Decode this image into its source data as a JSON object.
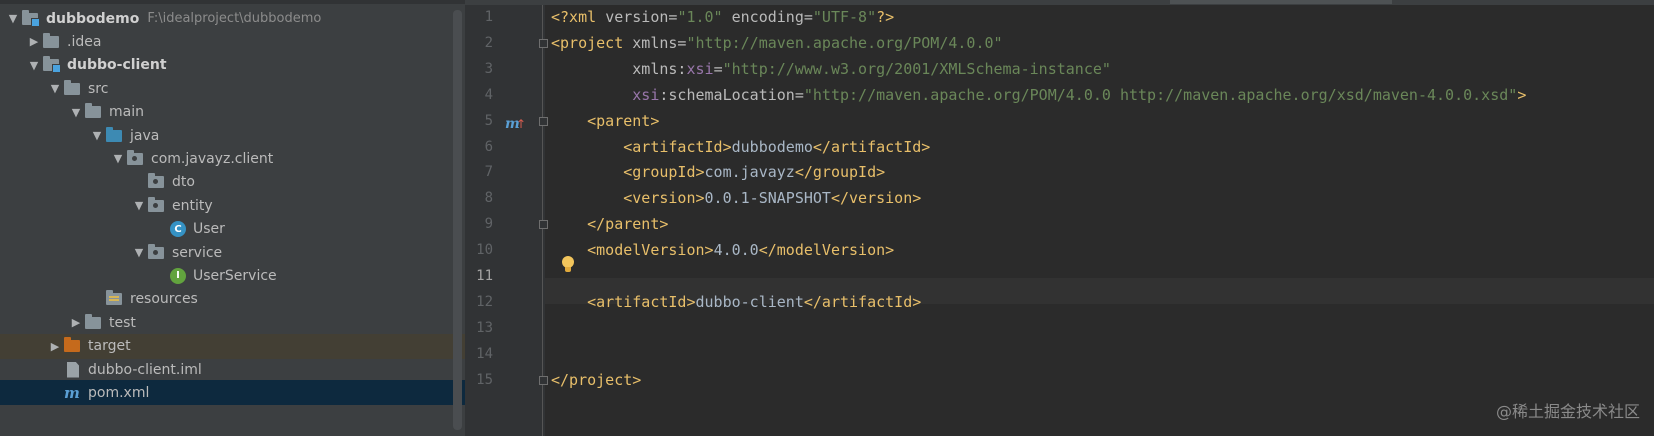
{
  "project_tree": [
    {
      "label": "dubbodemo",
      "path": "F:\\idealproject\\dubbodemo",
      "bold": true,
      "arrow": "down",
      "icon": "module-folder-icon"
    },
    {
      "label": ".idea",
      "arrow": "right",
      "icon": "folder-icon"
    },
    {
      "label": "dubbo-client",
      "bold": true,
      "arrow": "down",
      "icon": "module-folder-icon"
    },
    {
      "label": "src",
      "arrow": "down",
      "icon": "folder-icon"
    },
    {
      "label": "main",
      "arrow": "down",
      "icon": "folder-icon"
    },
    {
      "label": "java",
      "arrow": "down",
      "icon": "source-folder-icon"
    },
    {
      "label": "com.javayz.client",
      "arrow": "down",
      "icon": "package-icon"
    },
    {
      "label": "dto",
      "arrow": "",
      "icon": "package-icon"
    },
    {
      "label": "entity",
      "arrow": "down",
      "icon": "package-icon"
    },
    {
      "label": "User",
      "arrow": "",
      "icon": "class-icon",
      "badge": "C"
    },
    {
      "label": "service",
      "arrow": "down",
      "icon": "package-icon"
    },
    {
      "label": "UserService",
      "arrow": "",
      "icon": "interface-icon",
      "badge": "I"
    },
    {
      "label": "resources",
      "arrow": "",
      "icon": "resources-folder-icon"
    },
    {
      "label": "test",
      "arrow": "right",
      "icon": "folder-icon"
    },
    {
      "label": "target",
      "arrow": "right",
      "icon": "excluded-folder-icon"
    },
    {
      "label": "dubbo-client.iml",
      "arrow": "",
      "icon": "iml-file-icon"
    },
    {
      "label": "pom.xml",
      "arrow": "",
      "icon": "maven-icon",
      "badge": "m"
    }
  ],
  "editor": {
    "line_numbers": [
      "1",
      "2",
      "3",
      "4",
      "5",
      "6",
      "7",
      "8",
      "9",
      "10",
      "11",
      "12",
      "13",
      "14",
      "15"
    ],
    "current_line": "11",
    "lines": [
      [
        {
          "t": "<?xml ",
          "c": "tag"
        },
        {
          "t": "version=",
          "c": "attr"
        },
        {
          "t": "\"1.0\" ",
          "c": "val"
        },
        {
          "t": "encoding=",
          "c": "attr"
        },
        {
          "t": "\"UTF-8\"",
          "c": "val"
        },
        {
          "t": "?>",
          "c": "tag"
        }
      ],
      [
        {
          "t": "<project ",
          "c": "tag"
        },
        {
          "t": "xmlns=",
          "c": "attr"
        },
        {
          "t": "\"http://maven.apache.org/POM/4.0.0\"",
          "c": "val"
        }
      ],
      [
        {
          "t": "         xmlns:",
          "c": "attr"
        },
        {
          "t": "xsi",
          "c": "ns"
        },
        {
          "t": "=",
          "c": "attr"
        },
        {
          "t": "\"http://www.w3.org/2001/XMLSchema-instance\"",
          "c": "val"
        }
      ],
      [
        {
          "t": "         ",
          "c": "attr"
        },
        {
          "t": "xsi",
          "c": "ns"
        },
        {
          "t": ":schemaLocation=",
          "c": "attr"
        },
        {
          "t": "\"http://maven.apache.org/POM/4.0.0 http://maven.apache.org/xsd/maven-4.0.0.xsd\"",
          "c": "val"
        },
        {
          "t": ">",
          "c": "tag"
        }
      ],
      [
        {
          "t": "    <parent>",
          "c": "tag"
        }
      ],
      [
        {
          "t": "        <artifactId>",
          "c": "tag"
        },
        {
          "t": "dubbodemo",
          "c": "text"
        },
        {
          "t": "</artifactId>",
          "c": "tag"
        }
      ],
      [
        {
          "t": "        <groupId>",
          "c": "tag"
        },
        {
          "t": "com.javayz",
          "c": "text"
        },
        {
          "t": "</groupId>",
          "c": "tag"
        }
      ],
      [
        {
          "t": "        <version>",
          "c": "tag"
        },
        {
          "t": "0.0.1-SNAPSHOT",
          "c": "text"
        },
        {
          "t": "</version>",
          "c": "tag"
        }
      ],
      [
        {
          "t": "    </parent>",
          "c": "tag"
        }
      ],
      [
        {
          "t": "    <modelVersion>",
          "c": "tag"
        },
        {
          "t": "4.0.0",
          "c": "text"
        },
        {
          "t": "</modelVersion>",
          "c": "tag"
        }
      ],
      [],
      [
        {
          "t": "    <artifactId>",
          "c": "tag"
        },
        {
          "t": "dubbo-client",
          "c": "text"
        },
        {
          "t": "</artifactId>",
          "c": "tag"
        }
      ],
      [],
      [],
      [
        {
          "t": "</project>",
          "c": "tag"
        }
      ]
    ],
    "gutter_marker": "m",
    "gutter_marker_arrow": "↑"
  },
  "watermark": "@稀土掘金技术社区",
  "colors": {
    "tag": "#e8bf6a",
    "attr": "#bababa",
    "ns": "#9876aa",
    "val": "#6a8759",
    "text": "#a9b7c6"
  }
}
